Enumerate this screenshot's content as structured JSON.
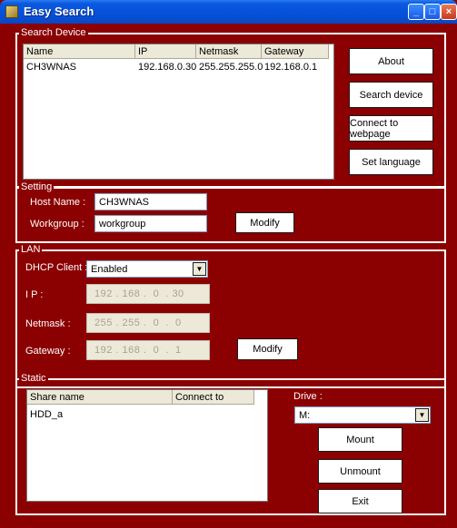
{
  "window": {
    "title": "Easy Search",
    "buttons": {
      "minimize": "_",
      "maximize": "□",
      "close": "×"
    }
  },
  "search_device": {
    "group_label": "Search Device",
    "columns": [
      "Name",
      "IP",
      "Netmask",
      "Gateway"
    ],
    "rows": [
      {
        "name": "CH3WNAS",
        "ip": "192.168.0.30",
        "netmask": "255.255.255.0",
        "gateway": "192.168.0.1"
      }
    ],
    "buttons": {
      "about": "About",
      "search_device": "Search device",
      "connect_webpage": "Connect to webpage",
      "set_language": "Set language"
    }
  },
  "setting": {
    "group_label": "Setting",
    "host_name_label": "Host Name :",
    "host_name_value": "CH3WNAS",
    "workgroup_label": "Workgroup :",
    "workgroup_value": "workgroup",
    "modify_label": "Modify"
  },
  "lan": {
    "group_label": "LAN",
    "dhcp_label": "DHCP Client :",
    "dhcp_value": "Enabled",
    "ip_label": "I P :",
    "ip_value": "192 . 168 .  0  . 30",
    "netmask_label": "Netmask :",
    "netmask_value": "255 . 255 .  0  .  0",
    "gateway_label": "Gateway :",
    "gateway_value": "192 . 168 .  0  .  1",
    "modify_label": "Modify"
  },
  "static": {
    "group_label": "Static",
    "columns": [
      "Share name",
      "Connect to"
    ],
    "rows": [
      {
        "share": "HDD_a",
        "connect": ""
      }
    ],
    "drive_label": "Drive :",
    "drive_value": "M:",
    "buttons": {
      "mount": "Mount",
      "unmount": "Unmount",
      "exit": "Exit"
    }
  }
}
